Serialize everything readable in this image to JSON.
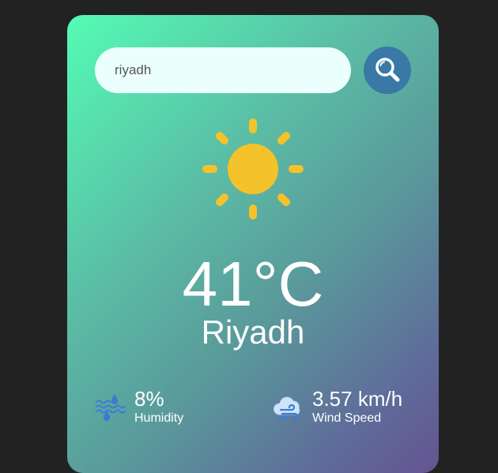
{
  "search": {
    "value": "riyadh",
    "button_icon": "search-icon"
  },
  "weather": {
    "icon": "sun-icon",
    "temperature": "41°C",
    "city": "Riyadh"
  },
  "humidity": {
    "icon": "humidity-icon",
    "value": "8%",
    "label": "Humidity"
  },
  "wind": {
    "icon": "wind-icon",
    "value": "3.57 km/h",
    "label": "Wind Speed"
  },
  "colors": {
    "page_background": "#222222",
    "card_gradient_start": "#53fcb4",
    "card_gradient_end": "#645491",
    "search_button": "#3a78a6",
    "sun": "#f4c22a",
    "text": "#ffffff"
  }
}
